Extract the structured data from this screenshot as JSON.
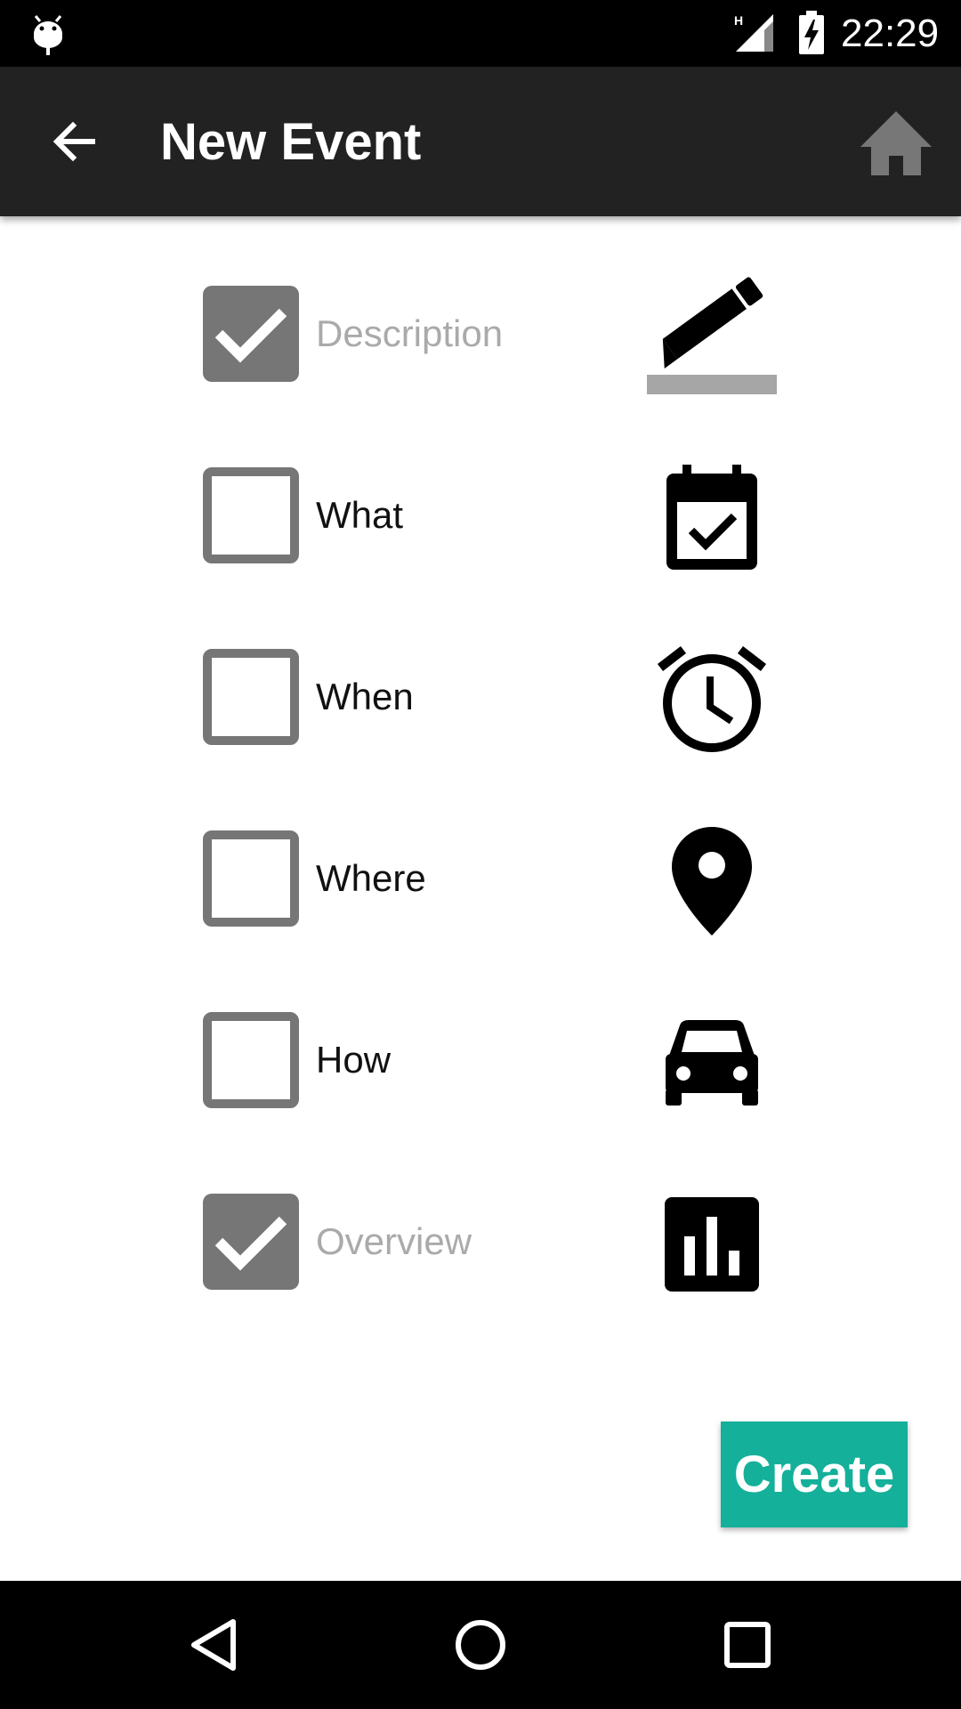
{
  "status_bar": {
    "time": "22:29",
    "network_type": "H",
    "icons": [
      "android-debug-icon",
      "signal-icon",
      "battery-charging-icon"
    ]
  },
  "app_bar": {
    "title": "New Event",
    "back_icon": "arrow-back-icon",
    "home_icon": "home-icon",
    "home_icon_color": "#777777"
  },
  "options": [
    {
      "label": "Description",
      "checked": true,
      "enabled": false,
      "icon": "edit-pencil-icon"
    },
    {
      "label": "What",
      "checked": false,
      "enabled": true,
      "icon": "event-calendar-check-icon"
    },
    {
      "label": "When",
      "checked": false,
      "enabled": true,
      "icon": "alarm-clock-icon"
    },
    {
      "label": "Where",
      "checked": false,
      "enabled": true,
      "icon": "location-pin-icon"
    },
    {
      "label": "How",
      "checked": false,
      "enabled": true,
      "icon": "car-icon"
    },
    {
      "label": "Overview",
      "checked": true,
      "enabled": false,
      "icon": "bar-chart-icon"
    }
  ],
  "create_button": {
    "label": "Create",
    "color": "#14B09A"
  },
  "nav_bar": {
    "buttons": [
      "back-triangle-icon",
      "home-circle-icon",
      "recents-square-icon"
    ]
  },
  "colors": {
    "app_bar_bg": "#222222",
    "checkbox_gray": "#767676",
    "disabled_text": "#AAAAAA"
  }
}
